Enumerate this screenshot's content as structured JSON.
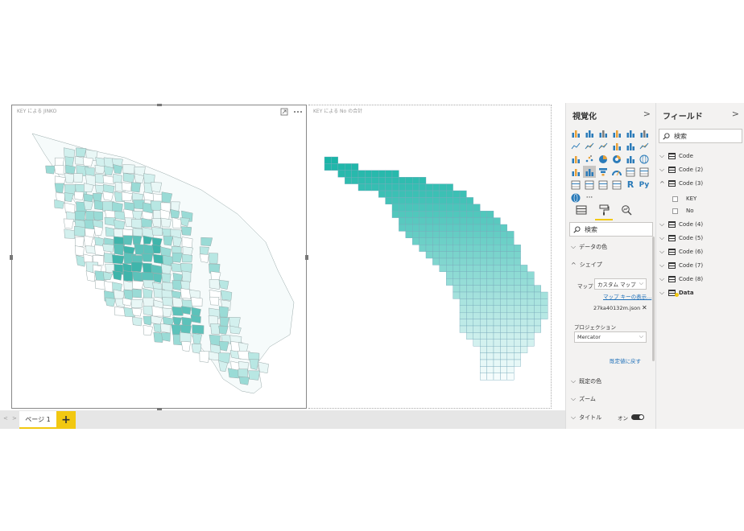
{
  "visuals": {
    "left_title": "KEY による JINKO",
    "right_title": "KEY による No の合計",
    "focus_icon": "focus-mode-icon",
    "more_icon": "more-options-icon"
  },
  "pages": {
    "tabs": [
      {
        "label": "ページ 1"
      }
    ],
    "add_label": "+",
    "prev_label": "<",
    "next_label": ">"
  },
  "viz_pane": {
    "title": "視覚化",
    "chevron": ">",
    "more_label": "···",
    "search_placeholder": "検索",
    "sections": {
      "data_colors": "データの色",
      "shape": "シェイプ",
      "default_colors": "既定の色",
      "zoom": "ズーム",
      "title": "タイトル"
    },
    "map_label": "マップ",
    "map_value": "カスタム マップ",
    "map_keys_link": "マップ キーの表示...",
    "map_file": "27ka40132m.json",
    "projection_label": "プロジェクション",
    "projection_value": "Mercator",
    "reset_link": "既定値に戻す",
    "title_toggle": "オン",
    "colors": {
      "accent": "#f2c811",
      "teal": "#1ab5a7"
    }
  },
  "fields_pane": {
    "title": "フィールド",
    "chevron": ">",
    "search_placeholder": "検索",
    "tables": [
      {
        "name": "Code",
        "expanded": false
      },
      {
        "name": "Code (2)",
        "expanded": false
      },
      {
        "name": "Code (3)",
        "expanded": true,
        "fields": [
          "KEY",
          "No"
        ]
      },
      {
        "name": "Code (4)",
        "expanded": false
      },
      {
        "name": "Code (5)",
        "expanded": false
      },
      {
        "name": "Code (6)",
        "expanded": false
      },
      {
        "name": "Code (7)",
        "expanded": false
      },
      {
        "name": "Code (8)",
        "expanded": false
      },
      {
        "name": "Data",
        "expanded": false,
        "in_use": true
      }
    ]
  }
}
